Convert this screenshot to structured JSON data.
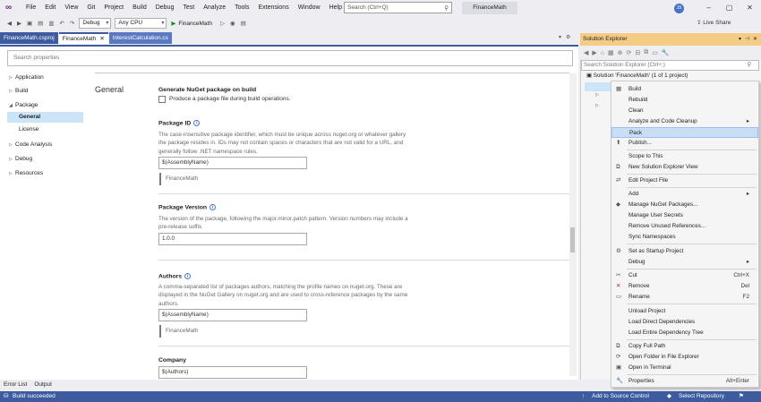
{
  "menubar": {
    "items": [
      "File",
      "Edit",
      "View",
      "Git",
      "Project",
      "Build",
      "Debug",
      "Test",
      "Analyze",
      "Tools",
      "Extensions",
      "Window",
      "Help"
    ],
    "search_placeholder": "Search (Ctrl+Q)",
    "app_title": "FinanceMath",
    "avatar_initials": "JS"
  },
  "toolbar": {
    "config": "Debug",
    "platform": "Any CPU",
    "run_target": "FinanceMath",
    "live_share": "Live Share"
  },
  "tabs": [
    {
      "label": "FinanceMath.csproj"
    },
    {
      "label": "FinanceMath"
    },
    {
      "label": "InterestCalculation.cs"
    }
  ],
  "props": {
    "search_placeholder": "Search properties",
    "nav": {
      "application": "Application",
      "build": "Build",
      "package": "Package",
      "general": "General",
      "license": "License",
      "code_analysis": "Code Analysis",
      "debug": "Debug",
      "resources": "Resources"
    },
    "section_title": "General",
    "generate_title": "Generate NuGet package on build",
    "generate_desc": "Produce a package file during build operations.",
    "package_id_title": "Package ID",
    "package_id_desc": "The case-insensitive package identifier, which must be unique across nuget.org or whatever gallery the package resides in. IDs may not contain spaces or characters that are not valid for a URL, and generally follow .NET namespace rules.",
    "package_id_value": "$(AssemblyName)",
    "package_id_resolved": "FinanceMath",
    "version_title": "Package Version",
    "version_desc": "The version of the package, following the major.minor.patch pattern. Version numbers may include a pre-release suffix.",
    "version_value": "1.0.0",
    "authors_title": "Authors",
    "authors_desc": "A comma-separated list of packages authors, matching the profile names on nuget.org. These are displayed in the NuGet Gallery on nuget.org and are used to cross-reference packages by the same authors.",
    "authors_value": "$(AssemblyName)",
    "authors_resolved": "FinanceMath",
    "company_title": "Company",
    "company_value": "$(Authors)"
  },
  "bottom": {
    "error_list": "Error List",
    "output": "Output"
  },
  "status": {
    "build": "Build succeeded",
    "source_control": "Add to Source Control",
    "repo": "Select Repository"
  },
  "solution_explorer": {
    "title": "Solution Explorer",
    "search_placeholder": "Search Solution Explorer (Ctrl+;)",
    "solution_label": "Solution 'FinanceMath' (1 of 1 project)"
  },
  "context_menu": {
    "build": "Build",
    "rebuild": "Rebuild",
    "clean": "Clean",
    "analyze": "Analyze and Code Cleanup",
    "pack": "Pack",
    "publish": "Publish...",
    "scope": "Scope to This",
    "new_view": "New Solution Explorer View",
    "edit_project": "Edit Project File",
    "add": "Add",
    "manage_nuget": "Manage NuGet Packages...",
    "manage_secrets": "Manage User Secrets",
    "remove_unused": "Remove Unused References...",
    "sync_ns": "Sync Namespaces",
    "startup": "Set as Startup Project",
    "debug": "Debug",
    "cut": "Cut",
    "cut_sc": "Ctrl+X",
    "remove": "Remove",
    "remove_sc": "Del",
    "rename": "Rename",
    "rename_sc": "F2",
    "unload": "Unload Project",
    "load_direct": "Load Direct Dependencies",
    "load_tree": "Load Entire Dependency Tree",
    "copy_path": "Copy Full Path",
    "open_folder": "Open Folder in File Explorer",
    "open_terminal": "Open in Terminal",
    "properties": "Properties",
    "properties_sc": "Alt+Enter"
  }
}
